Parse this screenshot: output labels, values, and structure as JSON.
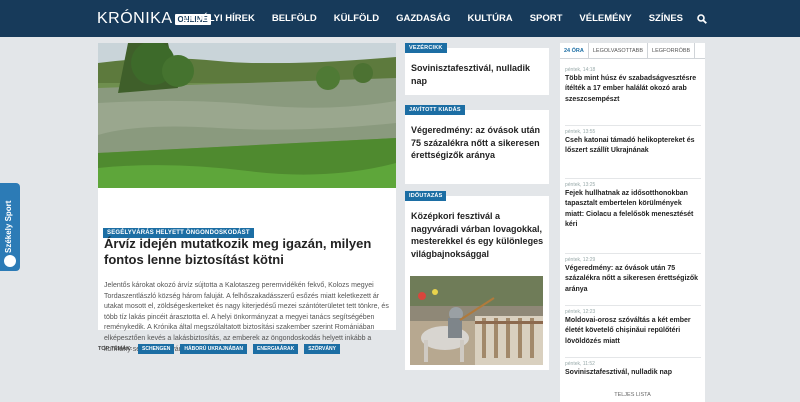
{
  "header": {
    "logo_text": "KRÓNIKA",
    "logo_badge": "ONLINE",
    "nav": [
      "ERDÉLYI HÍREK",
      "BELFÖLD",
      "KÜLFÖLD",
      "GAZDASÁG",
      "KULTÚRA",
      "SPORT",
      "VÉLEMÉNY",
      "SZÍNES"
    ],
    "search_icon": "search-icon"
  },
  "side_tab": {
    "label": "Székely Sport"
  },
  "main": {
    "kicker": "SEGÉLYVÁRÁS HELYETT ÖNGONDOSKODÁST",
    "title": "Árvíz idején mutatkozik meg igazán, milyen fontos lenne biztosítást kötni",
    "excerpt": "Jelentős károkat okozó árvíz sújtotta a Kalotaszeg peremvidékén fekvő, Kolozs megyei Tordaszentlászló község három faluját. A felhőszakadásszerű esőzés miatt keletkezett ár utakat mosott el, zöldségeskerteket és nagy kiterjedésű mezei szántóterületet tett tönkre, és több tíz lakás pincéit árasztotta el. A helyi önkormányzat a megyei tanács segítségében reménykedik. A Krónika által megszólaltatott biztosítási szakember szerint Romániában elképesztően kevés a lakásbiztosítás, az emberek az öngondoskodás helyett inkább a kormány segítségére várnak."
  },
  "topics": {
    "label": "TOP TÉMÁK:",
    "tags": [
      "SCHENGEN",
      "HÁBORÚ UKRAJNÁBAN",
      "ENERGIAÁRAK",
      "SZÖRVÁNY"
    ]
  },
  "middle": [
    {
      "kicker": "VEZÉRCIKK",
      "title": "Sovinisztafesztivál, nulladik nap"
    },
    {
      "kicker": "JAVÍTOTT KIADÁS",
      "title": "Végeredmény: az óvások után 75 százalékra nőtt a sikeresen érettségizők aránya"
    },
    {
      "kicker": "IDŐUTAZÁS",
      "title": "Középkori fesztivál a nagyváradi várban lovagokkal, mesterekkel és egy különleges világbajnoksággal"
    }
  ],
  "sidebar": {
    "tabs": [
      "24 ÓRA",
      "LEGOLVASOTTABB",
      "LEGFORRÓBB"
    ],
    "items": [
      {
        "time": "péntek, 14:18",
        "title": "Több mint húsz év szabadságvesztésre ítélték a 17 ember halálát okozó arab szeszcsempészt"
      },
      {
        "time": "péntek, 13:55",
        "title": "Cseh katonai támadó helikoptereket és lőszert szállít Ukrajnának"
      },
      {
        "time": "péntek, 13:25",
        "title": "Fejek hullhatnak az idősotthonokban tapasztalt embertelen körülmények miatt: Ciolacu a felelősök menesztését kéri"
      },
      {
        "time": "péntek, 12:29",
        "title": "Végeredmény: az óvások után 75 százalékra nőtt a sikeresen érettségizők aránya"
      },
      {
        "time": "péntek, 12:23",
        "title": "Moldovai-orosz szóváltás a két ember életét követelő chișinăui repülőtéri lövöldözés miatt"
      },
      {
        "time": "péntek, 11:52",
        "title": "Sovinisztafesztivál, nulladik nap"
      }
    ],
    "full_list": "TELJES LISTA"
  },
  "colors": {
    "header_bg": "#173a5a",
    "accent": "#1c6ea4",
    "page_bg": "#e3e6e9"
  }
}
